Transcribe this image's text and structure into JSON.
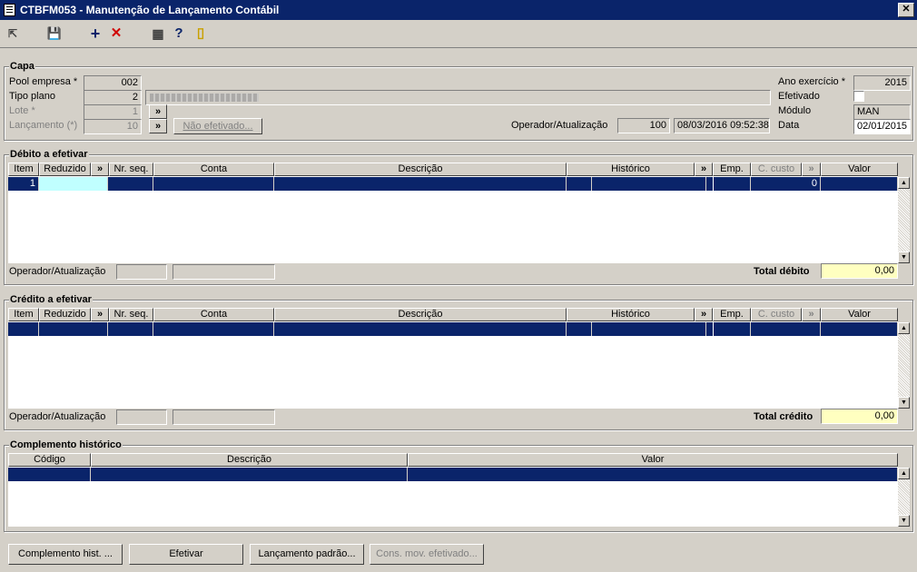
{
  "window": {
    "title": "CTBFM053 - Manutenção de Lançamento Contábil",
    "close": "✕"
  },
  "toolbar": {
    "exit": "⇱",
    "save": "💾",
    "add": "+",
    "delete": "✕",
    "calendar": "▦",
    "help": "?",
    "door": "▯"
  },
  "capa": {
    "title": "Capa",
    "pool_label": "Pool empresa *",
    "pool_value": "002",
    "tipo_label": "Tipo plano",
    "tipo_value": "2",
    "lote_label": "Lote *",
    "lote_value": "1",
    "lanc_label": "Lançamento (*)",
    "lanc_value": "10",
    "expand": "»",
    "nao_efetivado": "Não efetivado...",
    "operador_label": "Operador/Atualização",
    "operador_value": "100",
    "operador_date": "08/03/2016 09:52:38",
    "ano_label": "Ano exercício *",
    "ano_value": "2015",
    "efetivado_label": "Efetivado",
    "modulo_label": "Módulo",
    "modulo_value": "MAN",
    "data_label": "Data",
    "data_value": "02/01/2015"
  },
  "debito": {
    "title": "Débito a efetivar",
    "columns": {
      "item": "Item",
      "reduzido": "Reduzido",
      "expand1": "»",
      "nrseq": "Nr. seq.",
      "conta": "Conta",
      "descricao": "Descrição",
      "historico": "Histórico",
      "expand2": "»",
      "emp": "Emp.",
      "ccusto": "C. custo",
      "expand3": "»",
      "valor": "Valor"
    },
    "rows": [
      {
        "item": "1",
        "ccusto": "0"
      }
    ],
    "operador_label": "Operador/Atualização",
    "total_label": "Total débito",
    "total_value": "0,00"
  },
  "credito": {
    "title": "Crédito a efetivar",
    "columns": {
      "item": "Item",
      "reduzido": "Reduzido",
      "expand1": "»",
      "nrseq": "Nr. seq.",
      "conta": "Conta",
      "descricao": "Descrição",
      "historico": "Histórico",
      "expand2": "»",
      "emp": "Emp.",
      "ccusto": "C. custo",
      "expand3": "»",
      "valor": "Valor"
    },
    "operador_label": "Operador/Atualização",
    "total_label": "Total crédito",
    "total_value": "0,00"
  },
  "complemento": {
    "title": "Complemento histórico",
    "columns": {
      "codigo": "Código",
      "descricao": "Descrição",
      "valor": "Valor"
    }
  },
  "buttons": {
    "complemento": "Complemento hist. ...",
    "efetivar": "Efetivar",
    "lanc_padrao": "Lançamento padrão...",
    "cons_mov": "Cons. mov. efetivado..."
  },
  "scroll": {
    "up": "▲",
    "down": "▼"
  },
  "colors": {
    "title_bar": "#0a246a",
    "selection": "#0a246a",
    "face": "#d4d0c8",
    "total_field": "#ffffc0",
    "edit_cell": "#c0ffff"
  }
}
